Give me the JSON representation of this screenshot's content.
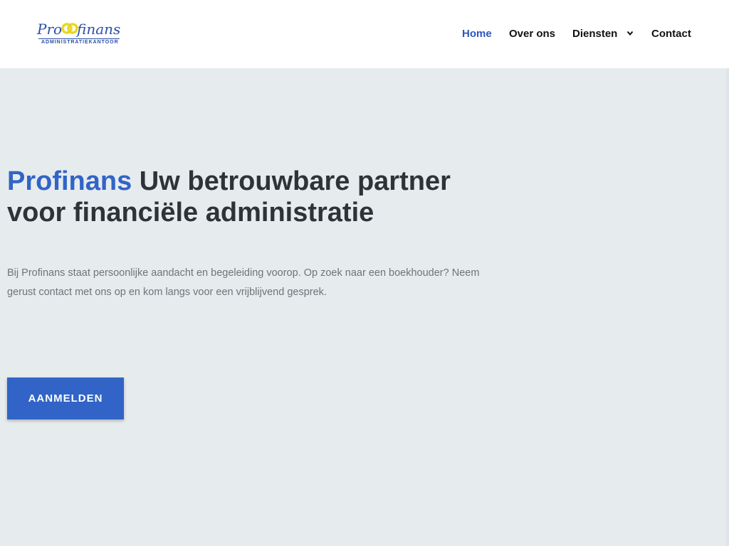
{
  "logo": {
    "pro_text": "Pro",
    "finans_text": "finans",
    "subtitle": "ADMINISTRATIEKANTOOR"
  },
  "nav": {
    "items": [
      {
        "label": "Home",
        "active": true
      },
      {
        "label": "Over ons",
        "active": false
      },
      {
        "label": "Diensten",
        "active": false,
        "has_dropdown": true
      },
      {
        "label": "Contact",
        "active": false
      }
    ]
  },
  "hero": {
    "brand": "Profinans",
    "title_rest": " Uw betrouwbare partner voor financiële administratie",
    "text": "Bij Profinans staat persoonlijke aandacht en begeleiding voorop. Op zoek naar een boekhouder? Neem gerust contact met ons op en kom langs voor een vrijblijvend gesprek.",
    "button_label": "AANMELDEN"
  },
  "colors": {
    "accent": "#3164c6",
    "nav_active": "#2e56c0",
    "background": "#e6ebee",
    "logo_blue": "#2b4fa8",
    "logo_yellow": "#f3e33a"
  },
  "icons": {
    "logo_mark": "two-interlocking-rings-icon",
    "dropdown": "chevron-down-icon"
  }
}
